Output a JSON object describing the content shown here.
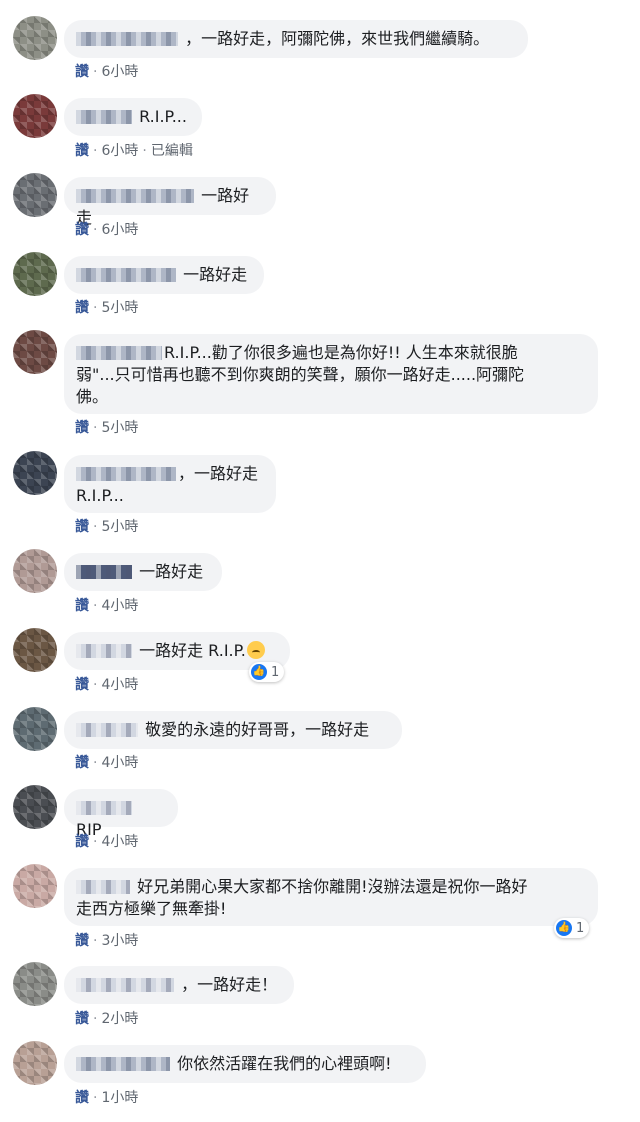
{
  "like_label": "讚",
  "edited_label": "已編輯",
  "comments": [
    {
      "text": "，一路好走，阿彌陀佛，來世我們繼續騎。",
      "time": "6小時"
    },
    {
      "text": "R.I.P...",
      "time": "6小時"
    },
    {
      "text": "一路好走",
      "time": "6小時"
    },
    {
      "text": "一路好走",
      "time": "5小時"
    },
    {
      "line1": "R.I.P...勸了你很多遍也是為你好!! 人生本來就很脆",
      "line2": "弱\"...只可惜再也聽不到你爽朗的笑聲，願你一路好走.....阿彌陀",
      "line3": "佛。",
      "time": "5小時"
    },
    {
      "line1": "，一路好走",
      "line2": "R.I.P...",
      "time": "5小時"
    },
    {
      "text": "一路好走",
      "time": "4小時"
    },
    {
      "text": "一路好走 R.I.P.",
      "time": "4小時",
      "reaction_count": "1",
      "reaction_icon": "thumbs-up-icon",
      "emoji": "disappointed-face-icon"
    },
    {
      "text": "敬愛的永遠的好哥哥，一路好走",
      "time": "4小時"
    },
    {
      "text": "RIP",
      "time": "4小時"
    },
    {
      "line1": "好兄弟開心果大家都不捨你離開!沒辦法還是祝你一路好",
      "line2": "走西方極樂了無牽掛!",
      "time": "3小時",
      "reaction_count": "1",
      "reaction_icon": "thumbs-up-icon"
    },
    {
      "text": "，一路好走！",
      "time": "2小時"
    },
    {
      "text": "你依然活躍在我們的心裡頭啊!",
      "time": "1小時"
    }
  ]
}
